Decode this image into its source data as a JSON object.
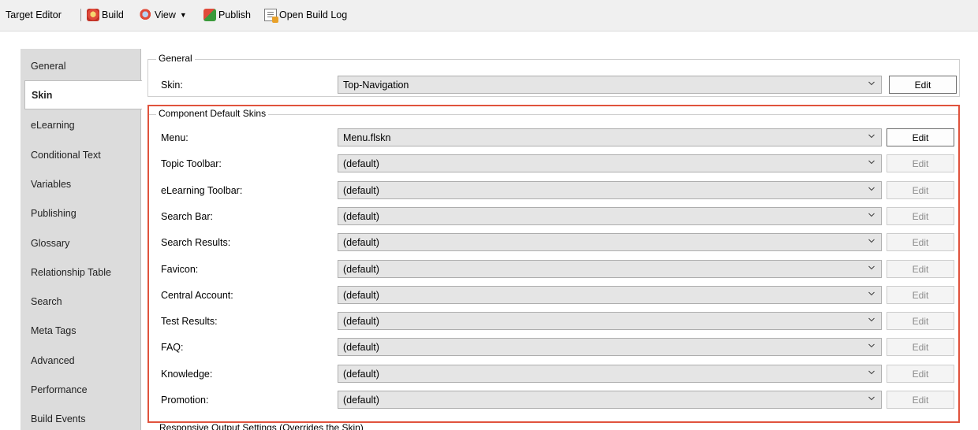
{
  "toolbar": {
    "title": "Target Editor",
    "build": "Build",
    "view": "View",
    "publish": "Publish",
    "open_log": "Open Build Log"
  },
  "tabs": [
    "General",
    "Skin",
    "eLearning",
    "Conditional Text",
    "Variables",
    "Publishing",
    "Glossary",
    "Relationship Table",
    "Search",
    "Meta Tags",
    "Advanced",
    "Performance",
    "Build Events"
  ],
  "active_tab": "Skin",
  "general_group": {
    "title": "General",
    "skin_label": "Skin:",
    "skin_value": "Top-Navigation",
    "edit": "Edit"
  },
  "component_group": {
    "title": "Component Default Skins",
    "edit": "Edit",
    "rows": [
      {
        "label": "Menu:",
        "value": "Menu.flskn",
        "edit_enabled": true
      },
      {
        "label": "Topic Toolbar:",
        "value": "(default)",
        "edit_enabled": false
      },
      {
        "label": "eLearning Toolbar:",
        "value": "(default)",
        "edit_enabled": false
      },
      {
        "label": "Search Bar:",
        "value": "(default)",
        "edit_enabled": false
      },
      {
        "label": "Search Results:",
        "value": "(default)",
        "edit_enabled": false
      },
      {
        "label": "Favicon:",
        "value": "(default)",
        "edit_enabled": false
      },
      {
        "label": "Central Account:",
        "value": "(default)",
        "edit_enabled": false
      },
      {
        "label": "Test Results:",
        "value": "(default)",
        "edit_enabled": false
      },
      {
        "label": "FAQ:",
        "value": "(default)",
        "edit_enabled": false
      },
      {
        "label": "Knowledge:",
        "value": "(default)",
        "edit_enabled": false
      },
      {
        "label": "Promotion:",
        "value": "(default)",
        "edit_enabled": false
      }
    ]
  },
  "responsive_group": {
    "title": "Responsive Output Settings (Overrides the Skin)"
  },
  "colors": {
    "highlight": "#e0533d"
  }
}
